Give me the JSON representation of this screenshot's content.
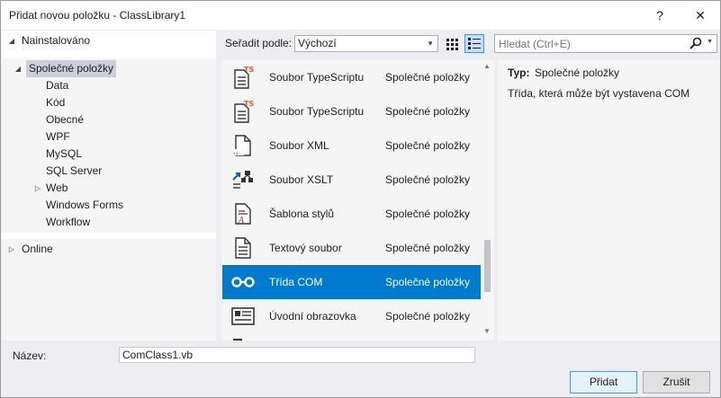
{
  "window": {
    "title": "Přidat novou položku - ClassLibrary1",
    "help_glyph": "?",
    "close_glyph": "✕"
  },
  "tree": {
    "installed": "Nainstalováno",
    "common": "Společné položky",
    "children": [
      "Data",
      "Kód",
      "Obecné",
      "WPF",
      "MySQL",
      "SQL Server",
      "Web",
      "Windows Forms",
      "Workflow"
    ],
    "online": "Online"
  },
  "toolbar": {
    "sort_label": "Seřadit podle:",
    "sort_value": "Výchozí",
    "search_placeholder": "Hledat (Ctrl+E)"
  },
  "templates": [
    {
      "name": "Soubor TypeScriptu",
      "category": "Společné položky",
      "icon": "typescript-file-icon"
    },
    {
      "name": "Soubor TypeScriptu",
      "category": "Společné položky",
      "icon": "typescript-file-icon"
    },
    {
      "name": "Soubor XML",
      "category": "Společné položky",
      "icon": "xml-file-icon"
    },
    {
      "name": "Soubor XSLT",
      "category": "Společné položky",
      "icon": "xslt-file-icon"
    },
    {
      "name": "Šablona stylů",
      "category": "Společné položky",
      "icon": "stylesheet-icon"
    },
    {
      "name": "Textový soubor",
      "category": "Společné položky",
      "icon": "text-file-icon"
    },
    {
      "name": "Třída COM",
      "category": "Společné položky",
      "icon": "com-class-icon",
      "selected": true
    },
    {
      "name": "Úvodní obrazovka",
      "category": "Společné položky",
      "icon": "splash-screen-icon"
    }
  ],
  "info": {
    "type_label": "Typ:",
    "type_value": "Společné položky",
    "description": "Třída, která může být vystavena COM"
  },
  "name_field": {
    "label": "Název:",
    "value": "ComClass1.vb"
  },
  "buttons": {
    "add": "Přidat",
    "cancel": "Zrušit"
  },
  "colors": {
    "selection": "#007acc",
    "tree_selection": "#cccedb",
    "ts_badge": "#e8562a"
  }
}
